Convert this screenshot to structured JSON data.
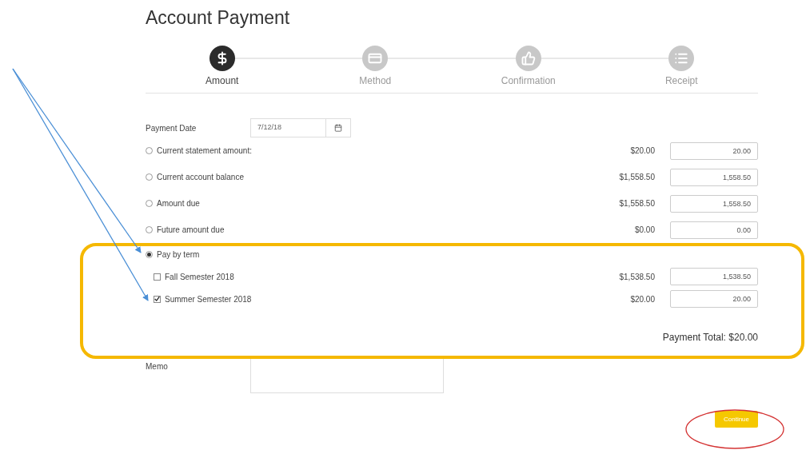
{
  "page": {
    "title": "Account Payment"
  },
  "steps": [
    {
      "label": "Amount",
      "selected": true
    },
    {
      "label": "Method",
      "selected": false
    },
    {
      "label": "Confirmation",
      "selected": false
    },
    {
      "label": "Receipt",
      "selected": false
    }
  ],
  "payment_date": {
    "label": "Payment Date",
    "value": "7/12/18"
  },
  "options": [
    {
      "label": "Current statement amount:",
      "amount": "$20.00",
      "value": "20.00",
      "selected": false
    },
    {
      "label": "Current account balance",
      "amount": "$1,558.50",
      "value": "1,558.50",
      "selected": false
    },
    {
      "label": "Amount due",
      "amount": "$1,558.50",
      "value": "1,558.50",
      "selected": false
    },
    {
      "label": "Future amount due",
      "amount": "$0.00",
      "value": "0.00",
      "selected": false
    }
  ],
  "pay_by_term": {
    "label": "Pay by term",
    "selected": true
  },
  "terms": [
    {
      "label": "Fall Semester 2018",
      "amount": "$1,538.50",
      "value": "1,538.50",
      "checked": false
    },
    {
      "label": "Summer Semester 2018",
      "amount": "$20.00",
      "value": "20.00",
      "checked": true
    }
  ],
  "payment_total": "Payment Total: $20.00",
  "memo": {
    "label": "Memo"
  },
  "continue_button": "Continue"
}
